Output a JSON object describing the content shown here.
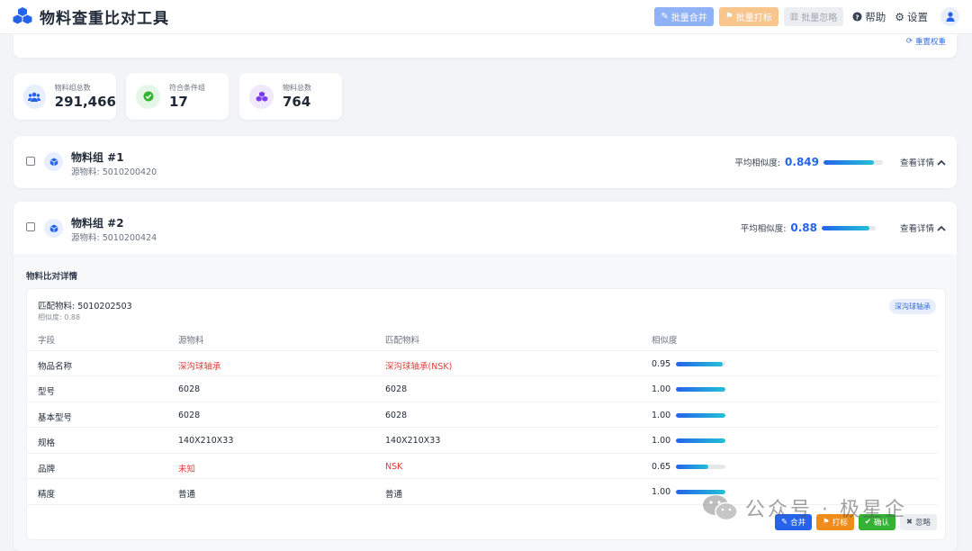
{
  "header": {
    "title": "物料查重比对工具",
    "batch_merge": "批量合并",
    "batch_tag": "批量打标",
    "batch_ignore": "批量忽略",
    "help": "帮助",
    "settings": "设置"
  },
  "filter": {
    "reset_weights": "重置权重"
  },
  "stats": [
    {
      "label": "物料组总数",
      "value": "291,466",
      "icon": "users-icon",
      "color": "#2563eb"
    },
    {
      "label": "符合条件组",
      "value": "17",
      "icon": "check-circle-icon",
      "color": "#34b233"
    },
    {
      "label": "物料总数",
      "value": "764",
      "icon": "cubes-icon",
      "color": "#7c3aed"
    }
  ],
  "groups": [
    {
      "title": "物料组 #1",
      "source": "源物料: 5010200420",
      "avg_label": "平均相似度:",
      "avg_value": "0.849",
      "avg_fraction": 0.849,
      "detail_label": "查看详情"
    },
    {
      "title": "物料组 #2",
      "source": "源物料: 5010200424",
      "avg_label": "平均相似度:",
      "avg_value": "0.88",
      "avg_fraction": 0.88,
      "detail_label": "查看详情"
    }
  ],
  "comparison": {
    "section_title": "物料比对详情",
    "match_code": "匹配物料: 5010202503",
    "match_similarity": "相似度: 0.88",
    "category_badge": "深沟球轴承",
    "columns": [
      "字段",
      "源物料",
      "匹配物料",
      "相似度"
    ],
    "rows": [
      {
        "field": "物品名称",
        "source": "深沟球轴承",
        "match": "深沟球轴承(NSK)",
        "similarity": "0.95",
        "fraction": 0.95,
        "diff": true
      },
      {
        "field": "型号",
        "source": "6028",
        "match": "6028",
        "similarity": "1.00",
        "fraction": 1.0,
        "diff": false
      },
      {
        "field": "基本型号",
        "source": "6028",
        "match": "6028",
        "similarity": "1.00",
        "fraction": 1.0,
        "diff": false
      },
      {
        "field": "规格",
        "source": "140X210X33",
        "match": "140X210X33",
        "similarity": "1.00",
        "fraction": 1.0,
        "diff": false
      },
      {
        "field": "品牌",
        "source": "未知",
        "match": "NSK",
        "similarity": "0.65",
        "fraction": 0.65,
        "diff": true
      },
      {
        "field": "精度",
        "source": "普通",
        "match": "普通",
        "similarity": "1.00",
        "fraction": 1.0,
        "diff": false
      }
    ],
    "actions": {
      "merge": "合并",
      "tag": "打标",
      "confirm": "确认",
      "ignore": "忽略"
    }
  },
  "watermark": "公众号 · 极星企"
}
